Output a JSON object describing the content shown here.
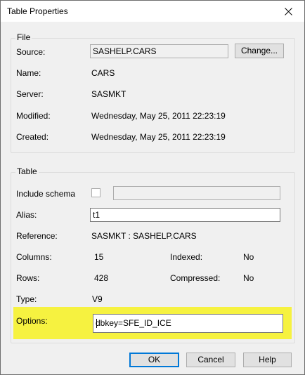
{
  "window": {
    "title": "Table Properties"
  },
  "file": {
    "group_label": "File",
    "source_label": "Source:",
    "source_value": "SASHELP.CARS",
    "change_button": "Change...",
    "name_label": "Name:",
    "name_value": "CARS",
    "server_label": "Server:",
    "server_value": "SASMKT",
    "modified_label": "Modified:",
    "modified_value": "Wednesday, May 25, 2011 22:23:19",
    "created_label": "Created:",
    "created_value": "Wednesday, May 25, 2011 22:23:19"
  },
  "table": {
    "group_label": "Table",
    "include_schema_label": "Include schema",
    "include_schema_checked": false,
    "schema_value": "",
    "alias_label": "Alias:",
    "alias_value": "t1",
    "reference_label": "Reference:",
    "reference_value": "SASMKT : SASHELP.CARS",
    "columns_label": "Columns:",
    "columns_value": "15",
    "indexed_label": "Indexed:",
    "indexed_value": "No",
    "rows_label": "Rows:",
    "rows_value": "428",
    "compressed_label": "Compressed:",
    "compressed_value": "No",
    "type_label": "Type:",
    "type_value": "V9",
    "options_label": "Options:",
    "options_value": "dbkey=SFE_ID_ICE",
    "highlight_color": "#f6f240"
  },
  "buttons": {
    "ok": "OK",
    "cancel": "Cancel",
    "help": "Help"
  }
}
